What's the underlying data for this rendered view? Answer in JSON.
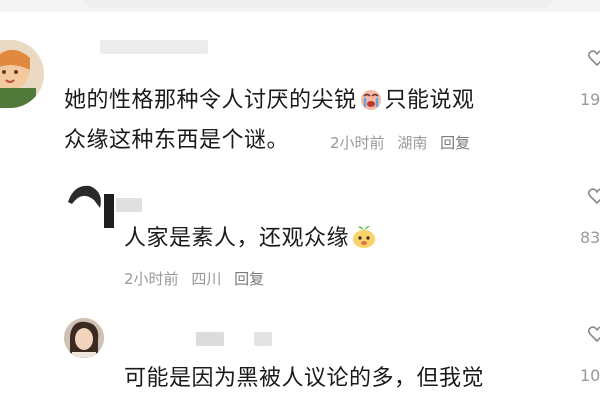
{
  "comments": [
    {
      "text_line1": "她的性格那种令人讨厌的尖锐",
      "text_line1_after_emoji": "只能说观",
      "text_line2": "众缘这种东西是个谜。",
      "time": "2小时前",
      "location": "湖南",
      "reply_label": "回复",
      "like_count": "19",
      "emoji": "crying-face-emoji"
    },
    {
      "text_line1": "人家是素人，还观众缘",
      "time": "2小时前",
      "location": "四川",
      "reply_label": "回复",
      "like_count": "83",
      "emoji": "sprout-bun-emoji"
    },
    {
      "text_line1": "可能是因为黑被人议论的多，但我觉",
      "like_count": "10"
    }
  ]
}
